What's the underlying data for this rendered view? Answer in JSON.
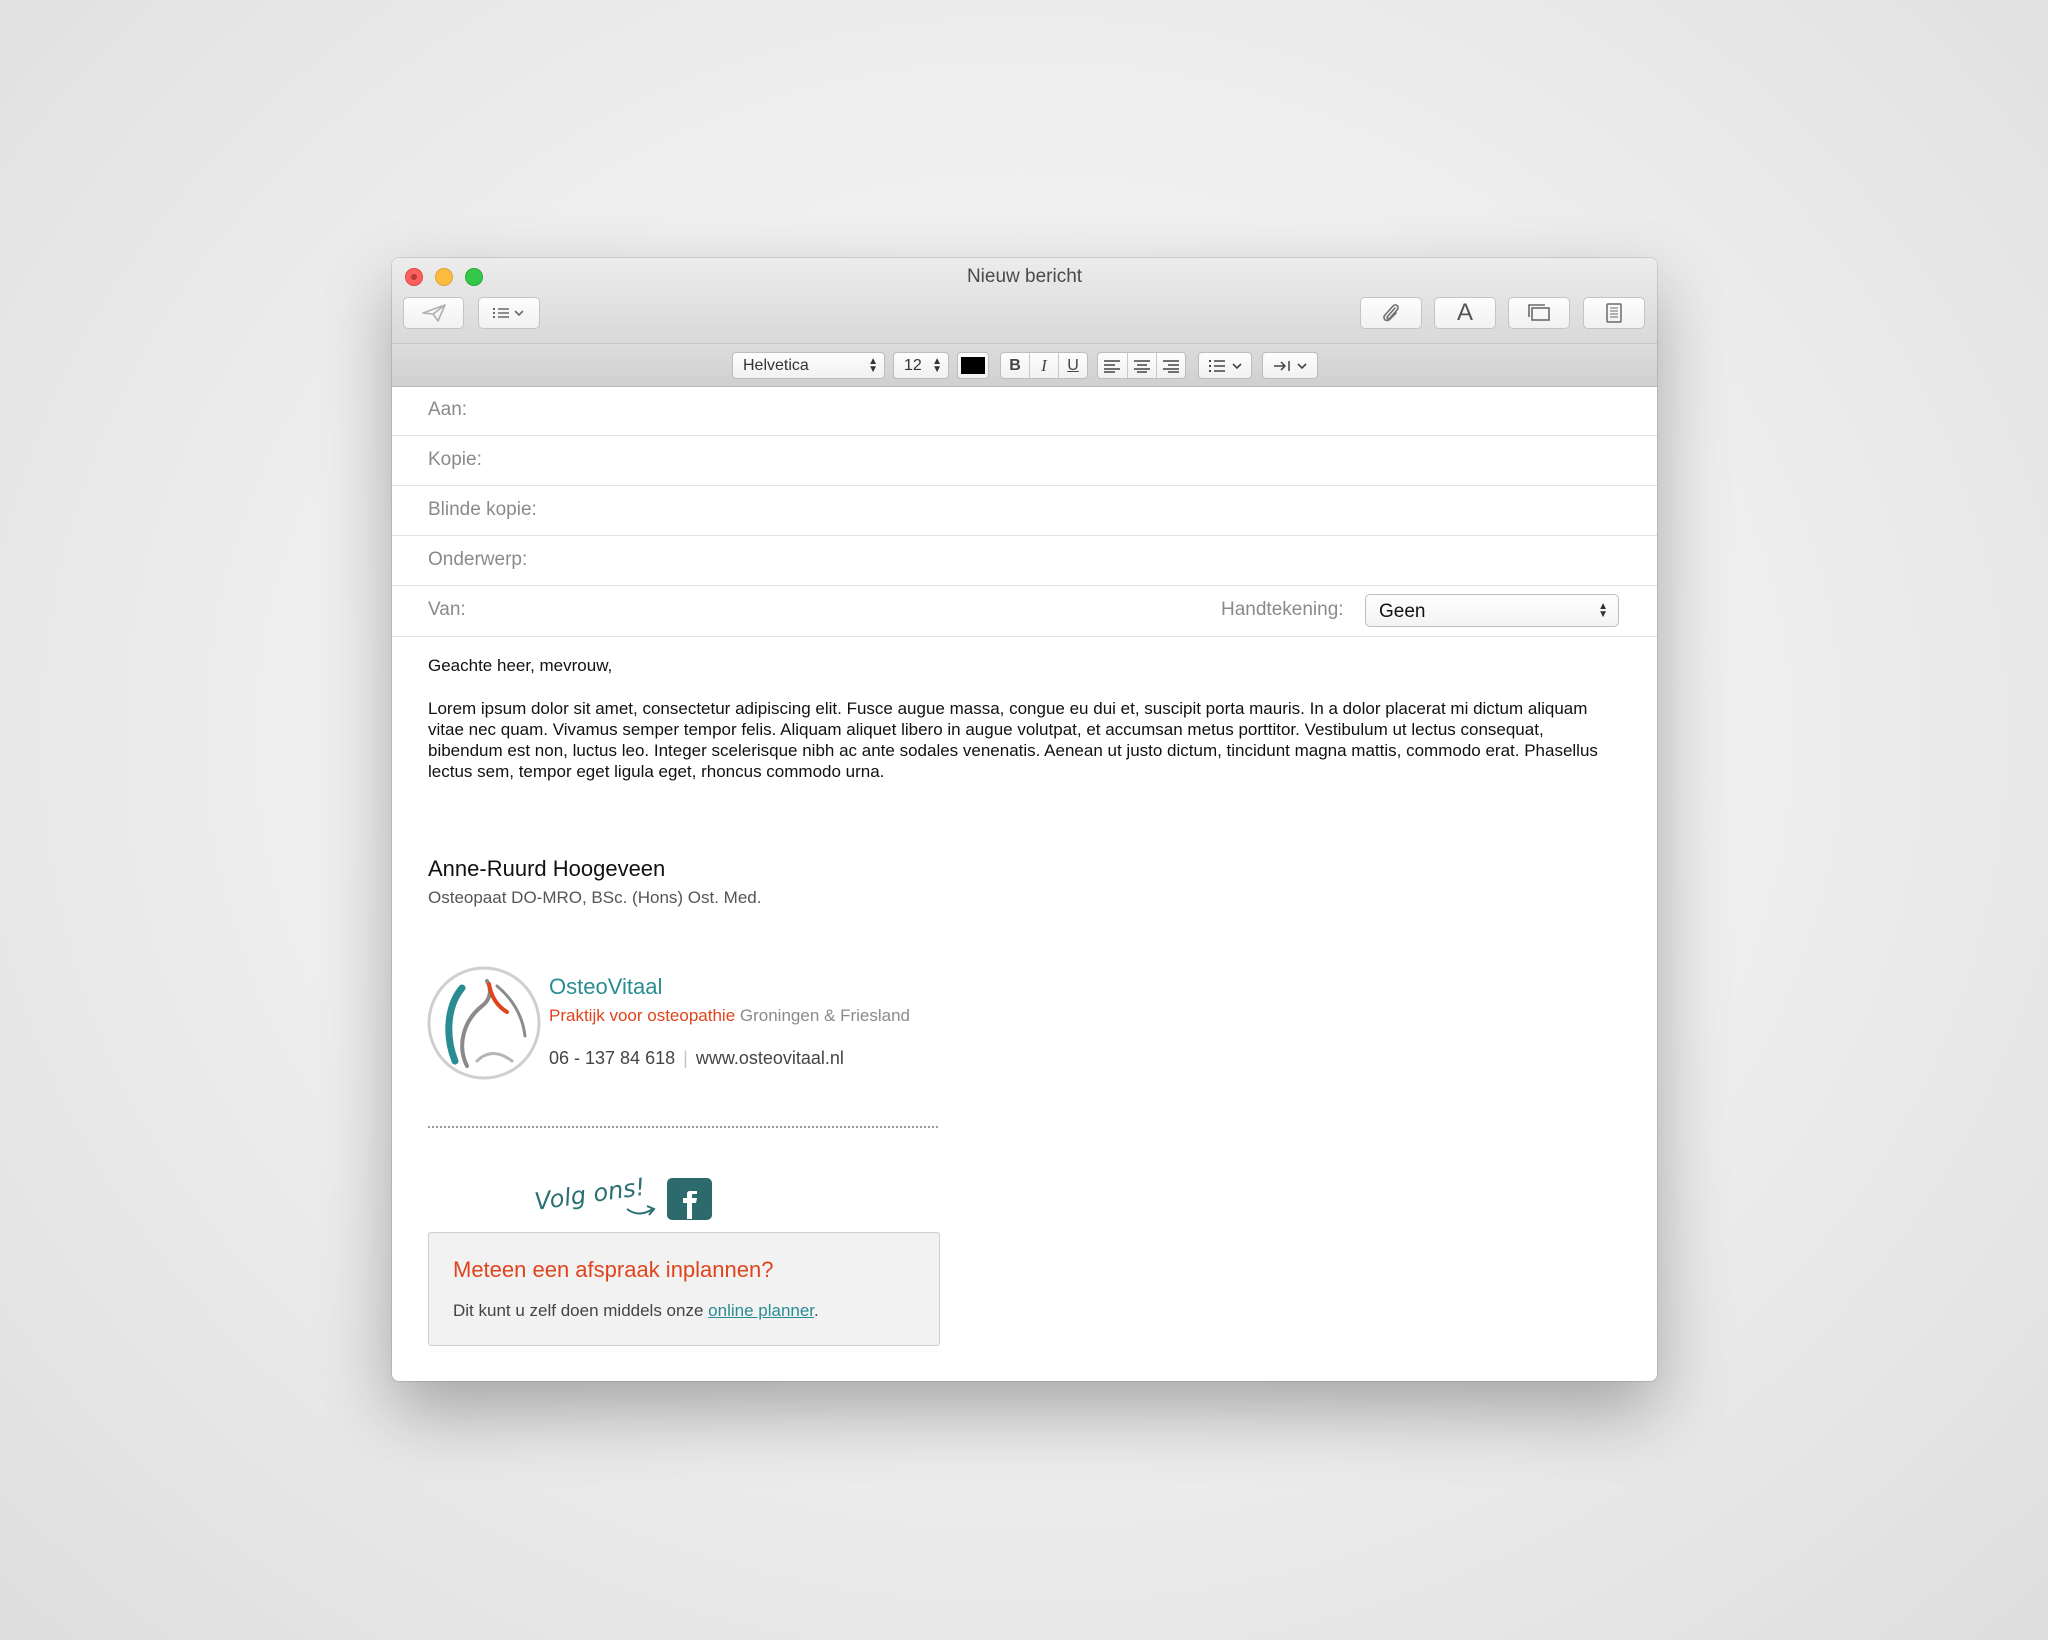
{
  "window": {
    "title": "Nieuw bericht"
  },
  "toolbar": {
    "send_icon": "paper-plane-icon",
    "header_menu_icon": "list-chevron-icon",
    "attach_icon": "paperclip-icon",
    "fonts_label": "A",
    "photo_browser_icon": "photo-browser-icon",
    "stationery_icon": "stationery-icon"
  },
  "format": {
    "font_family": "Helvetica",
    "font_size": "12",
    "text_color": "#000000",
    "bold": "B",
    "italic": "I",
    "underline": "U"
  },
  "headers": {
    "to_label": "Aan:",
    "cc_label": "Kopie:",
    "bcc_label": "Blinde kopie:",
    "subject_label": "Onderwerp:",
    "from_label": "Van:",
    "signature_label": "Handtekening:",
    "signature_value": "Geen"
  },
  "body": {
    "greeting": "Geachte heer, mevrouw,",
    "paragraph": "Lorem ipsum dolor sit amet, consectetur adipiscing elit. Fusce augue massa, congue eu dui et, suscipit porta mauris. In a dolor placerat mi dictum aliquam vitae nec quam. Vivamus semper tempor felis. Aliquam aliquet libero in augue volutpat, et accumsan metus porttitor. Vestibulum ut lectus consequat, bibendum est non, luctus leo. Integer scelerisque nibh ac ante sodales venenatis. Aenean ut justo dictum, tincidunt magna mattis, commodo erat. Phasellus lectus sem, tempor eget ligula eget, rhoncus commodo urna."
  },
  "signature": {
    "name": "Anne-Ruurd Hoogeveen",
    "credentials": "Osteopaat DO-MRO, BSc. (Hons) Ost. Med.",
    "brand": "OsteoVitaal",
    "tagline_highlight": "Praktijk voor osteopathie",
    "tagline_rest": "Groningen & Friesland",
    "phone": "06 - 137 84 618",
    "separator": "|",
    "website": "www.osteovitaal.nl",
    "follow_text": "Volg ons!",
    "cta_title": "Meteen een afspraak inplannen?",
    "cta_text": "Dit kunt u zelf doen middels onze",
    "cta_link": "online planner",
    "cta_end": "."
  },
  "colors": {
    "brand_teal": "#2a8c93",
    "brand_orange": "#e0441c"
  }
}
